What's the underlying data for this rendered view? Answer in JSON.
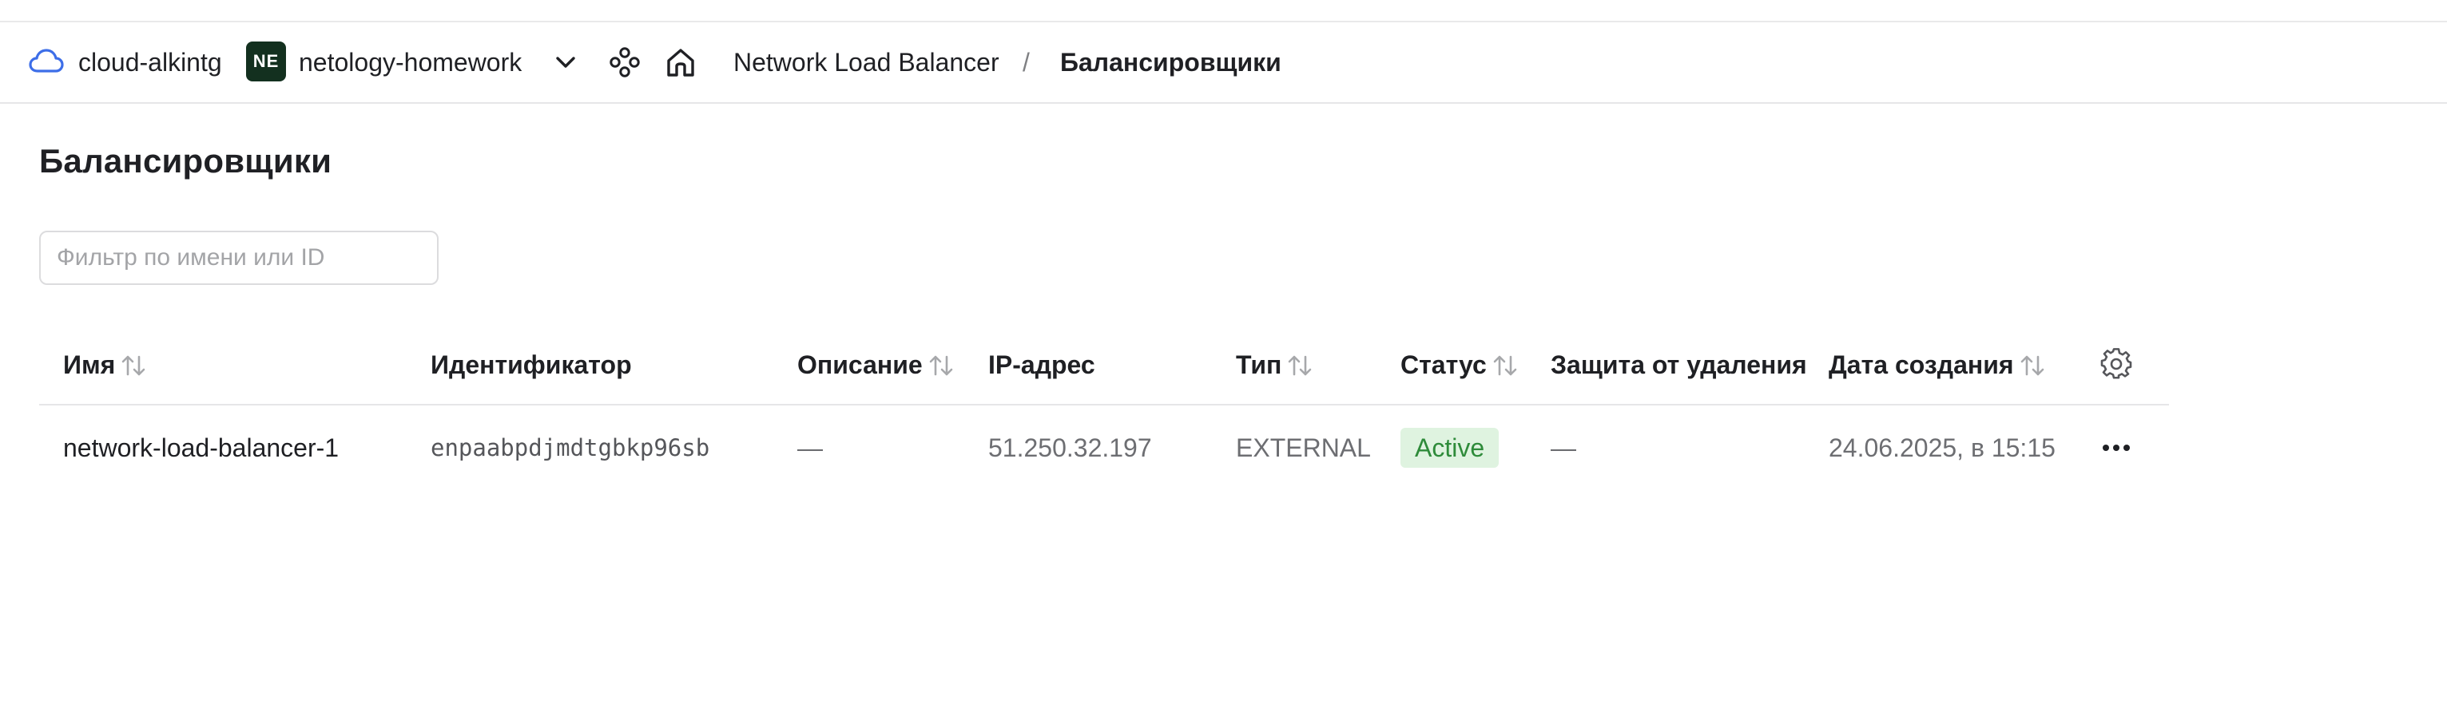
{
  "header": {
    "cloud_name": "cloud-alkintg",
    "folder_badge": "NE",
    "folder_name": "netology-homework",
    "breadcrumb_service": "Network Load Balancer",
    "breadcrumb_separator": "/",
    "breadcrumb_current": "Балансировщики",
    "icons": [
      "cloud-icon",
      "chevron-down-icon",
      "services-icon",
      "home-icon"
    ]
  },
  "page": {
    "title": "Балансировщики",
    "filter_placeholder": "Фильтр по имени или ID",
    "filter_value": ""
  },
  "table": {
    "columns": [
      {
        "label": "Имя",
        "sortable": true
      },
      {
        "label": "Идентификатор",
        "sortable": false
      },
      {
        "label": "Описание",
        "sortable": true
      },
      {
        "label": "IP-адрес",
        "sortable": false
      },
      {
        "label": "Тип",
        "sortable": true
      },
      {
        "label": "Статус",
        "sortable": true
      },
      {
        "label": "Защита от удаления",
        "sortable": false
      },
      {
        "label": "Дата создания",
        "sortable": true
      }
    ],
    "rows": [
      {
        "name": "network-load-balancer-1",
        "id": "enpaabpdjmdtgbkp96sb",
        "description": "—",
        "ip": "51.250.32.197",
        "type": "EXTERNAL",
        "status": "Active",
        "deletion_protection": "—",
        "created": "24.06.2025, в 15:15"
      }
    ]
  },
  "colors": {
    "accent_cloud": "#3d6ee8",
    "folder_badge_bg": "#13301f",
    "status_active_bg": "#dff3e0",
    "status_active_text": "#2e8b3a"
  }
}
